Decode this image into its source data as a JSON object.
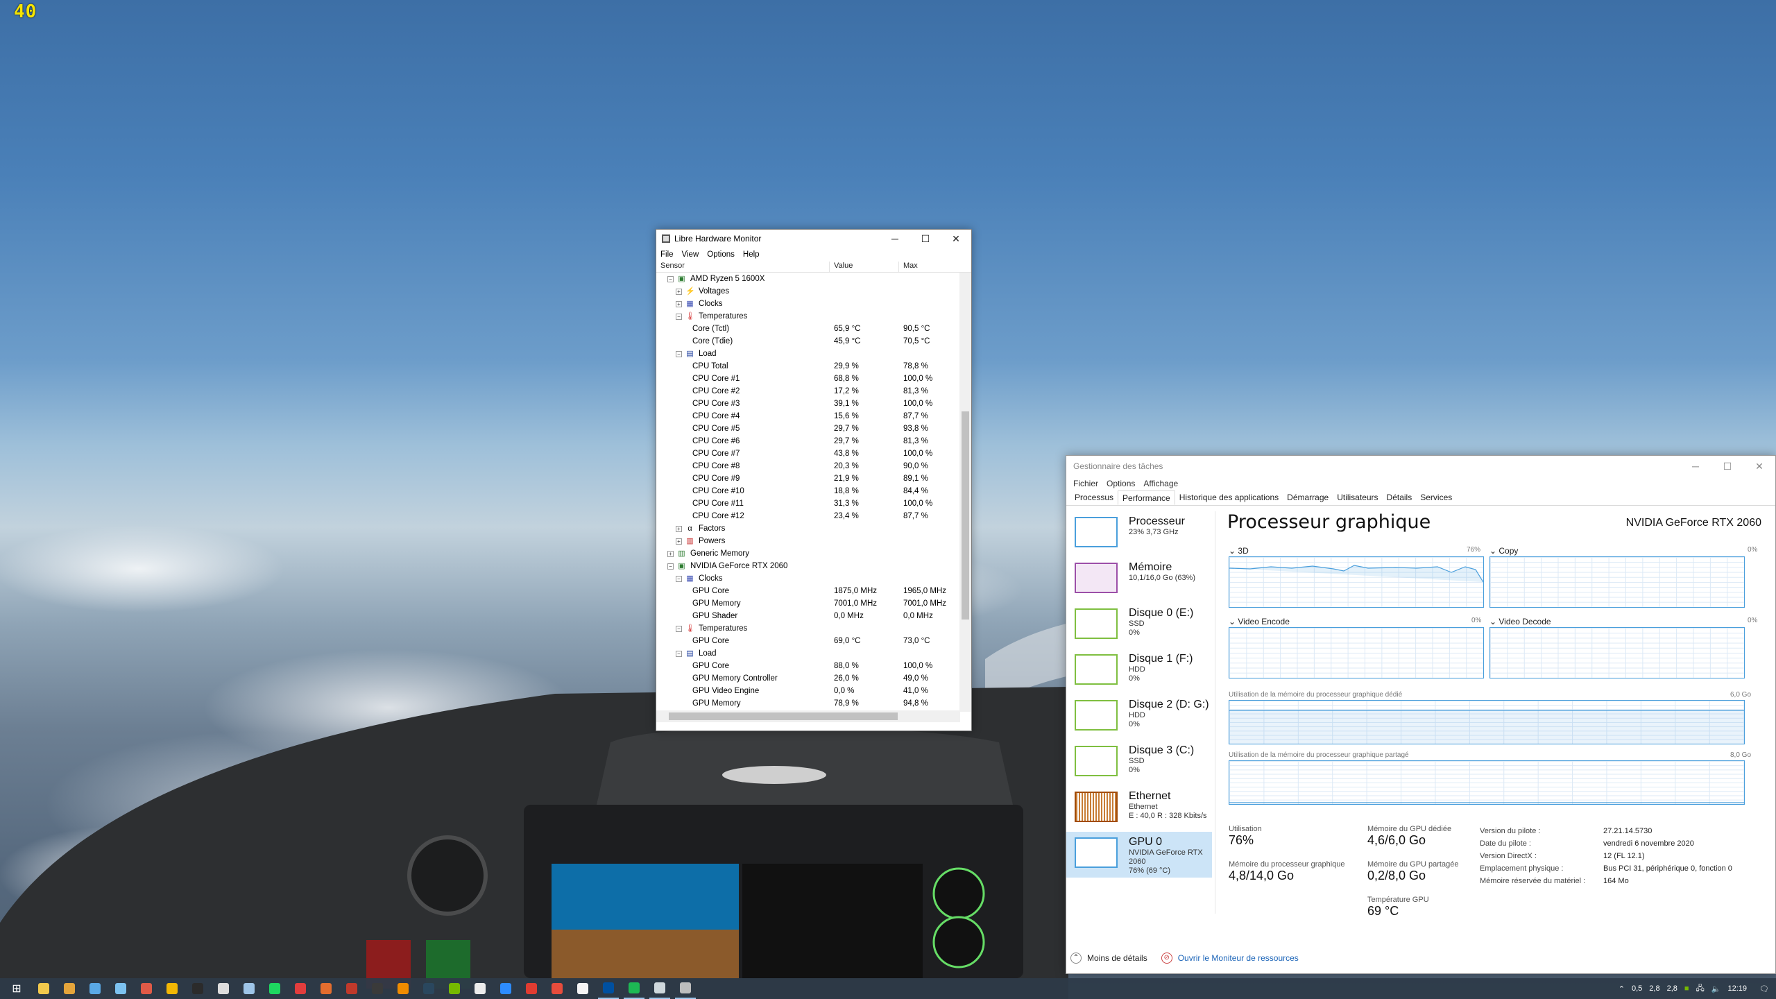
{
  "fps": "40",
  "lhm": {
    "title": "Libre Hardware Monitor",
    "menu": [
      "File",
      "View",
      "Options",
      "Help"
    ],
    "columns": {
      "sensor": "Sensor",
      "value": "Value",
      "max": "Max"
    },
    "rows": [
      {
        "level": 1,
        "exp": "-",
        "icon": "cpu-chip-icon",
        "label": "AMD Ryzen 5 1600X",
        "value": "",
        "max": ""
      },
      {
        "level": 2,
        "exp": "+",
        "icon": "voltage-icon",
        "label": "Voltages",
        "value": "",
        "max": ""
      },
      {
        "level": 2,
        "exp": "+",
        "icon": "clock-icon",
        "label": "Clocks",
        "value": "",
        "max": ""
      },
      {
        "level": 2,
        "exp": "-",
        "icon": "thermometer-icon",
        "label": "Temperatures",
        "value": "",
        "max": ""
      },
      {
        "level": 3,
        "label": "Core (Tctl)",
        "value": "65,9 °C",
        "max": "90,5 °C"
      },
      {
        "level": 3,
        "label": "Core (Tdie)",
        "value": "45,9 °C",
        "max": "70,5 °C"
      },
      {
        "level": 2,
        "exp": "-",
        "icon": "load-icon",
        "label": "Load",
        "value": "",
        "max": ""
      },
      {
        "level": 3,
        "label": "CPU Total",
        "value": "29,9 %",
        "max": "78,8 %"
      },
      {
        "level": 3,
        "label": "CPU Core #1",
        "value": "68,8 %",
        "max": "100,0 %"
      },
      {
        "level": 3,
        "label": "CPU Core #2",
        "value": "17,2 %",
        "max": "81,3 %"
      },
      {
        "level": 3,
        "label": "CPU Core #3",
        "value": "39,1 %",
        "max": "100,0 %"
      },
      {
        "level": 3,
        "label": "CPU Core #4",
        "value": "15,6 %",
        "max": "87,7 %"
      },
      {
        "level": 3,
        "label": "CPU Core #5",
        "value": "29,7 %",
        "max": "93,8 %"
      },
      {
        "level": 3,
        "label": "CPU Core #6",
        "value": "29,7 %",
        "max": "81,3 %"
      },
      {
        "level": 3,
        "label": "CPU Core #7",
        "value": "43,8 %",
        "max": "100,0 %"
      },
      {
        "level": 3,
        "label": "CPU Core #8",
        "value": "20,3 %",
        "max": "90,0 %"
      },
      {
        "level": 3,
        "label": "CPU Core #9",
        "value": "21,9 %",
        "max": "89,1 %"
      },
      {
        "level": 3,
        "label": "CPU Core #10",
        "value": "18,8 %",
        "max": "84,4 %"
      },
      {
        "level": 3,
        "label": "CPU Core #11",
        "value": "31,3 %",
        "max": "100,0 %"
      },
      {
        "level": 3,
        "label": "CPU Core #12",
        "value": "23,4 %",
        "max": "87,7 %"
      },
      {
        "level": 2,
        "exp": "+",
        "icon": "factors-icon",
        "label": "Factors",
        "value": "",
        "max": ""
      },
      {
        "level": 2,
        "exp": "+",
        "icon": "power-icon",
        "label": "Powers",
        "value": "",
        "max": ""
      },
      {
        "level": 1,
        "exp": "+",
        "icon": "memory-icon",
        "label": "Generic Memory",
        "value": "",
        "max": ""
      },
      {
        "level": 1,
        "exp": "-",
        "icon": "gpu-card-icon",
        "label": "NVIDIA GeForce RTX 2060",
        "value": "",
        "max": ""
      },
      {
        "level": 2,
        "exp": "-",
        "icon": "clock-icon",
        "label": "Clocks",
        "value": "",
        "max": ""
      },
      {
        "level": 3,
        "label": "GPU Core",
        "value": "1875,0 MHz",
        "max": "1965,0 MHz"
      },
      {
        "level": 3,
        "label": "GPU Memory",
        "value": "7001,0 MHz",
        "max": "7001,0 MHz"
      },
      {
        "level": 3,
        "label": "GPU Shader",
        "value": "0,0 MHz",
        "max": "0,0 MHz"
      },
      {
        "level": 2,
        "exp": "-",
        "icon": "thermometer-icon",
        "label": "Temperatures",
        "value": "",
        "max": ""
      },
      {
        "level": 3,
        "label": "GPU Core",
        "value": "69,0 °C",
        "max": "73,0 °C"
      },
      {
        "level": 2,
        "exp": "-",
        "icon": "load-icon",
        "label": "Load",
        "value": "",
        "max": ""
      },
      {
        "level": 3,
        "label": "GPU Core",
        "value": "88,0 %",
        "max": "100,0 %"
      },
      {
        "level": 3,
        "label": "GPU Memory Controller",
        "value": "26,0 %",
        "max": "49,0 %"
      },
      {
        "level": 3,
        "label": "GPU Video Engine",
        "value": "0,0 %",
        "max": "41,0 %"
      },
      {
        "level": 3,
        "label": "GPU Memory",
        "value": "78,9 %",
        "max": "94,8 %"
      }
    ]
  },
  "tm": {
    "title": "Gestionnaire des tâches",
    "menu": [
      "Fichier",
      "Options",
      "Affichage"
    ],
    "tabs": [
      "Processus",
      "Performance",
      "Historique des applications",
      "Démarrage",
      "Utilisateurs",
      "Détails",
      "Services"
    ],
    "active_tab": "Performance",
    "side": [
      {
        "cls": "cpu",
        "name": "Processeur",
        "d1": "23% 3,73 GHz",
        "d2": ""
      },
      {
        "cls": "mem",
        "name": "Mémoire",
        "d1": "10,1/16,0 Go (63%)",
        "d2": ""
      },
      {
        "cls": "disk",
        "name": "Disque 0 (E:)",
        "d1": "SSD",
        "d2": "0%"
      },
      {
        "cls": "disk",
        "name": "Disque 1 (F:)",
        "d1": "HDD",
        "d2": "0%"
      },
      {
        "cls": "disk",
        "name": "Disque 2 (D: G:)",
        "d1": "HDD",
        "d2": "0%"
      },
      {
        "cls": "disk",
        "name": "Disque 3 (C:)",
        "d1": "SSD",
        "d2": "0%"
      },
      {
        "cls": "eth",
        "name": "Ethernet",
        "d1": "Ethernet",
        "d2": "E : 40,0  R : 328 Kbits/s"
      },
      {
        "cls": "gpu sel",
        "name": "GPU 0",
        "d1": "NVIDIA GeForce RTX 2060",
        "d2": "76% (69 °C)"
      }
    ],
    "heading": "Processeur graphique",
    "gpu_name": "NVIDIA GeForce RTX 2060",
    "g3d": {
      "label": "3D",
      "pct": "76%"
    },
    "gcopy": {
      "label": "Copy",
      "pct": "0%"
    },
    "gvenc": {
      "label": "Video Encode",
      "pct": "0%"
    },
    "gvdec": {
      "label": "Video Decode",
      "pct": "0%"
    },
    "gded": {
      "label": "Utilisation de la mémoire du processeur graphique dédié",
      "max": "6,0 Go"
    },
    "gsha": {
      "label": "Utilisation de la mémoire du processeur graphique partagé",
      "max": "8,0 Go"
    },
    "stats": {
      "util_l": "Utilisation",
      "util_v": "76%",
      "proc_mem_l": "Mémoire du processeur graphique",
      "proc_mem_v": "4,8/14,0 Go",
      "ded_l": "Mémoire du GPU dédiée",
      "ded_v": "4,6/6,0 Go",
      "sha_l": "Mémoire du GPU partagée",
      "sha_v": "0,2/8,0 Go",
      "temp_l": "Température GPU",
      "temp_v": "69 °C"
    },
    "kv": [
      {
        "k": "Version du pilote :",
        "v": "27.21.14.5730"
      },
      {
        "k": "Date du pilote :",
        "v": "vendredi 6 novembre 2020"
      },
      {
        "k": "Version DirectX :",
        "v": "12 (FL 12.1)"
      },
      {
        "k": "Emplacement physique :",
        "v": "Bus PCI 31, périphérique 0, fonction 0"
      },
      {
        "k": "Mémoire réservée du matériel :",
        "v": "164 Mo"
      }
    ],
    "footer": {
      "less": "Moins de détails",
      "monitor": "Ouvrir le Moniteur de ressources"
    }
  },
  "taskbar": {
    "apps": [
      "#f2c94c",
      "#e5a53b",
      "#5aa9e6",
      "#7cc2f0",
      "#e05a47",
      "#f2b705",
      "#2b2b2b",
      "#ddd",
      "#9ec5e8",
      "#1ed760",
      "#e23d3d",
      "#e36d2e",
      "#c0392b",
      "#3a3a3a",
      "#f08c00",
      "#2a475e",
      "#76b900",
      "#ececec",
      "#2d8cff",
      "#e03c31",
      "#e74c3c",
      "#f5f5f5",
      "#0050a0",
      "#1db954",
      "#cfd8dc",
      "#bdbdbd"
    ],
    "tray": {
      "v1": "0,5",
      "v2": "2,8",
      "v3": "2,8",
      "time": "12:19"
    }
  }
}
